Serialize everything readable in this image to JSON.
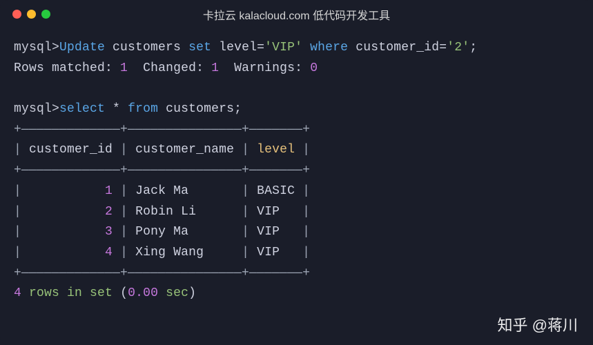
{
  "window": {
    "title": "卡拉云 kalacloud.com 低代码开发工具"
  },
  "terminal": {
    "prompt": "mysql>",
    "cmd1": {
      "Update": "Update",
      "customers": "customers",
      "set": "set",
      "level_eq": "level=",
      "vip": "'VIP'",
      "where": "where",
      "customer_id_eq": "customer_id=",
      "two": "'2'",
      "semi": ";"
    },
    "result1": {
      "rows_matched": "Rows matched:",
      "rows_matched_val": "1",
      "changed": "Changed:",
      "changed_val": "1",
      "warnings": "Warnings:",
      "warnings_val": "0"
    },
    "cmd2": {
      "select": "select",
      "star": "*",
      "from": "from",
      "customers": "customers",
      "semi": ";"
    },
    "table": {
      "border_top": "+—————————————+———————————————+———————+",
      "border_mid": "+—————————————+———————————————+———————+",
      "border_bot": "+—————————————+———————————————+———————+",
      "pipe": "|",
      "headers": {
        "col1": " customer_id ",
        "col2": " customer_name ",
        "col3": " level "
      },
      "rows": [
        {
          "id": "1",
          "name": "Jack Ma",
          "level": "BASIC"
        },
        {
          "id": "2",
          "name": "Robin Li",
          "level": "VIP"
        },
        {
          "id": "3",
          "name": "Pony Ma",
          "level": "VIP"
        },
        {
          "id": "4",
          "name": "Xing Wang",
          "level": "VIP"
        }
      ]
    },
    "summary": {
      "count": "4",
      "rows_in_set": "rows in set",
      "paren_open": "(",
      "time": "0.00",
      "sec": "sec",
      "paren_close": ")"
    }
  },
  "watermark": "知乎 @蒋川"
}
